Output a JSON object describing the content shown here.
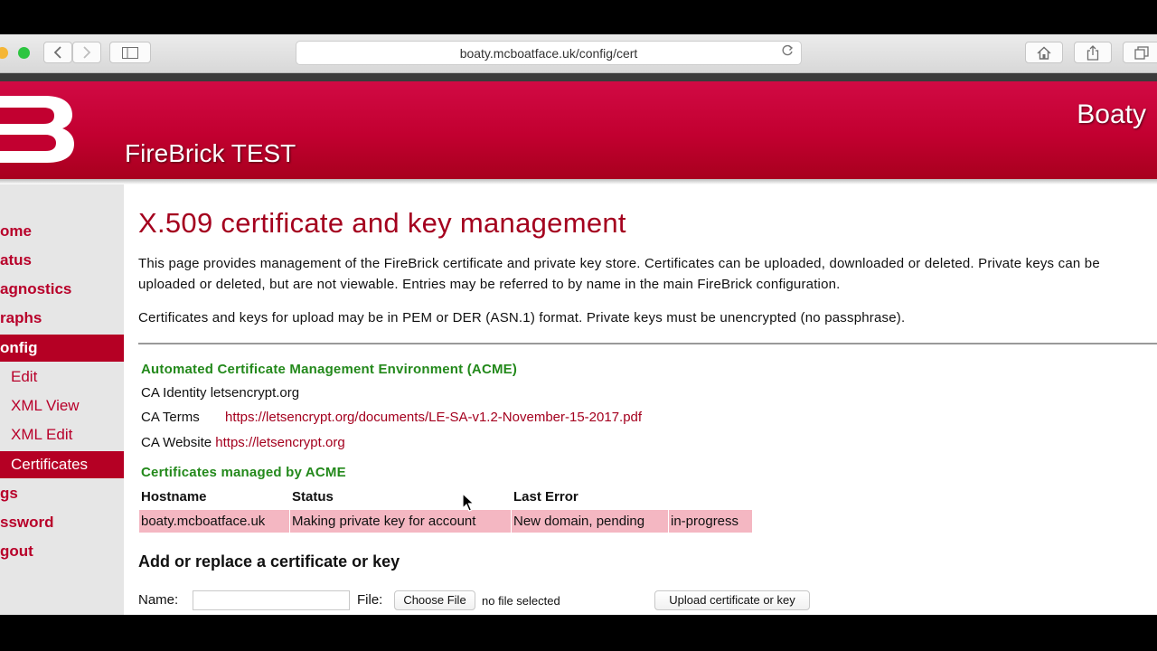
{
  "browser": {
    "url": "boaty.mcboatface.uk/config/cert"
  },
  "site": {
    "title": "FireBrick TEST",
    "hostname": "Boaty",
    "brand_color": "#c20030"
  },
  "nav": {
    "items": [
      {
        "label": "ome",
        "sub": false,
        "active": false
      },
      {
        "label": "atus",
        "sub": false,
        "active": false
      },
      {
        "label": "agnostics",
        "sub": false,
        "active": false
      },
      {
        "label": "raphs",
        "sub": false,
        "active": false
      },
      {
        "label": "onfig",
        "sub": false,
        "active": true
      },
      {
        "label": "Edit",
        "sub": true,
        "active": false
      },
      {
        "label": "XML View",
        "sub": true,
        "active": false
      },
      {
        "label": "XML Edit",
        "sub": true,
        "active": false
      },
      {
        "label": "Certificates",
        "sub": true,
        "active": true
      },
      {
        "label": "gs",
        "sub": false,
        "active": false
      },
      {
        "label": "ssword",
        "sub": false,
        "active": false
      },
      {
        "label": "gout",
        "sub": false,
        "active": false
      }
    ]
  },
  "page": {
    "title": "X.509 certificate and key management",
    "intro1": "This page provides management of the FireBrick certificate and private key store. Certificates can be uploaded, downloaded or deleted. Private keys can be uploaded or deleted, but are not viewable. Entries may be referred to by name in the main FireBrick configuration.",
    "intro2": "Certificates and keys for upload may be in PEM or DER (ASN.1) format. Private keys must be unencrypted (no passphrase).",
    "acme": {
      "heading": "Automated Certificate Management Environment (ACME)",
      "ca_identity_label": "CA Identity",
      "ca_identity": "letsencrypt.org",
      "ca_terms_label": "CA Terms",
      "ca_terms": "https://letsencrypt.org/documents/LE-SA-v1.2-November-15-2017.pdf",
      "ca_website_label": "CA Website",
      "ca_website": "https://letsencrypt.org"
    },
    "managed": {
      "heading": "Certificates managed by ACME",
      "columns": [
        "Hostname",
        "Status",
        "Last Error"
      ],
      "rows": [
        [
          "boaty.mcboatface.uk",
          "Making private key for account",
          "New domain, pending",
          "in-progress"
        ]
      ]
    },
    "upload": {
      "heading": "Add or replace a certificate or key",
      "name_label": "Name:",
      "file_label": "File:",
      "choose_button": "Choose File",
      "no_file": "no file selected",
      "upload_button": "Upload certificate or key"
    }
  }
}
